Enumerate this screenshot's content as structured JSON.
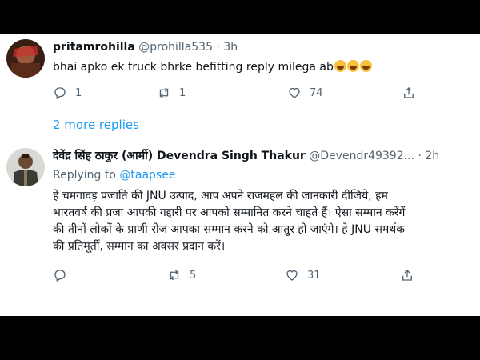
{
  "tweets": [
    {
      "display_name": "pritamrohilla",
      "handle": "@prohilla535",
      "separator": "·",
      "time": "3h",
      "text": "bhai apko ek truck bhrke befitting reply milega ab",
      "emoji": [
        "rolling-on-floor-laughing",
        "rolling-on-floor-laughing",
        "zany-face"
      ],
      "replies": "1",
      "retweets": "1",
      "likes": "74"
    },
    {
      "display_name": "देवेंद्र सिंह ठाकुर (आर्मी) Devendra Singh Thakur",
      "handle": "@Devendr49392...",
      "separator": "·",
      "time": "2h",
      "replying_label": "Replying to",
      "replying_handle": "@taapsee",
      "text_lines": [
        "हे चमगादड़ प्रजाति की JNU उत्पाद, आप अपने राजमहल की जानकारी दीजिये, हम",
        "भारतवर्ष की प्रजा आपकी गद्दारी पर आपको सम्मानित करने चाहते हैं। ऐसा सम्मान करेंगें",
        "की तीनों लोकों के प्राणी रोज आपका सम्मान करने को आतुर हो जाएंगे। हे JNU समर्थक",
        "की प्रतिमूर्ती, सम्मान का अवसर प्रदान करें।"
      ],
      "replies": "",
      "retweets": "5",
      "likes": "31"
    }
  ],
  "more_replies": "2 more replies",
  "icons": [
    "reply-icon",
    "retweet-icon",
    "like-icon",
    "share-icon"
  ],
  "colors": {
    "link": "#1d9bf0",
    "muted": "#536471",
    "text": "#0f1419",
    "frame": "#000000"
  }
}
